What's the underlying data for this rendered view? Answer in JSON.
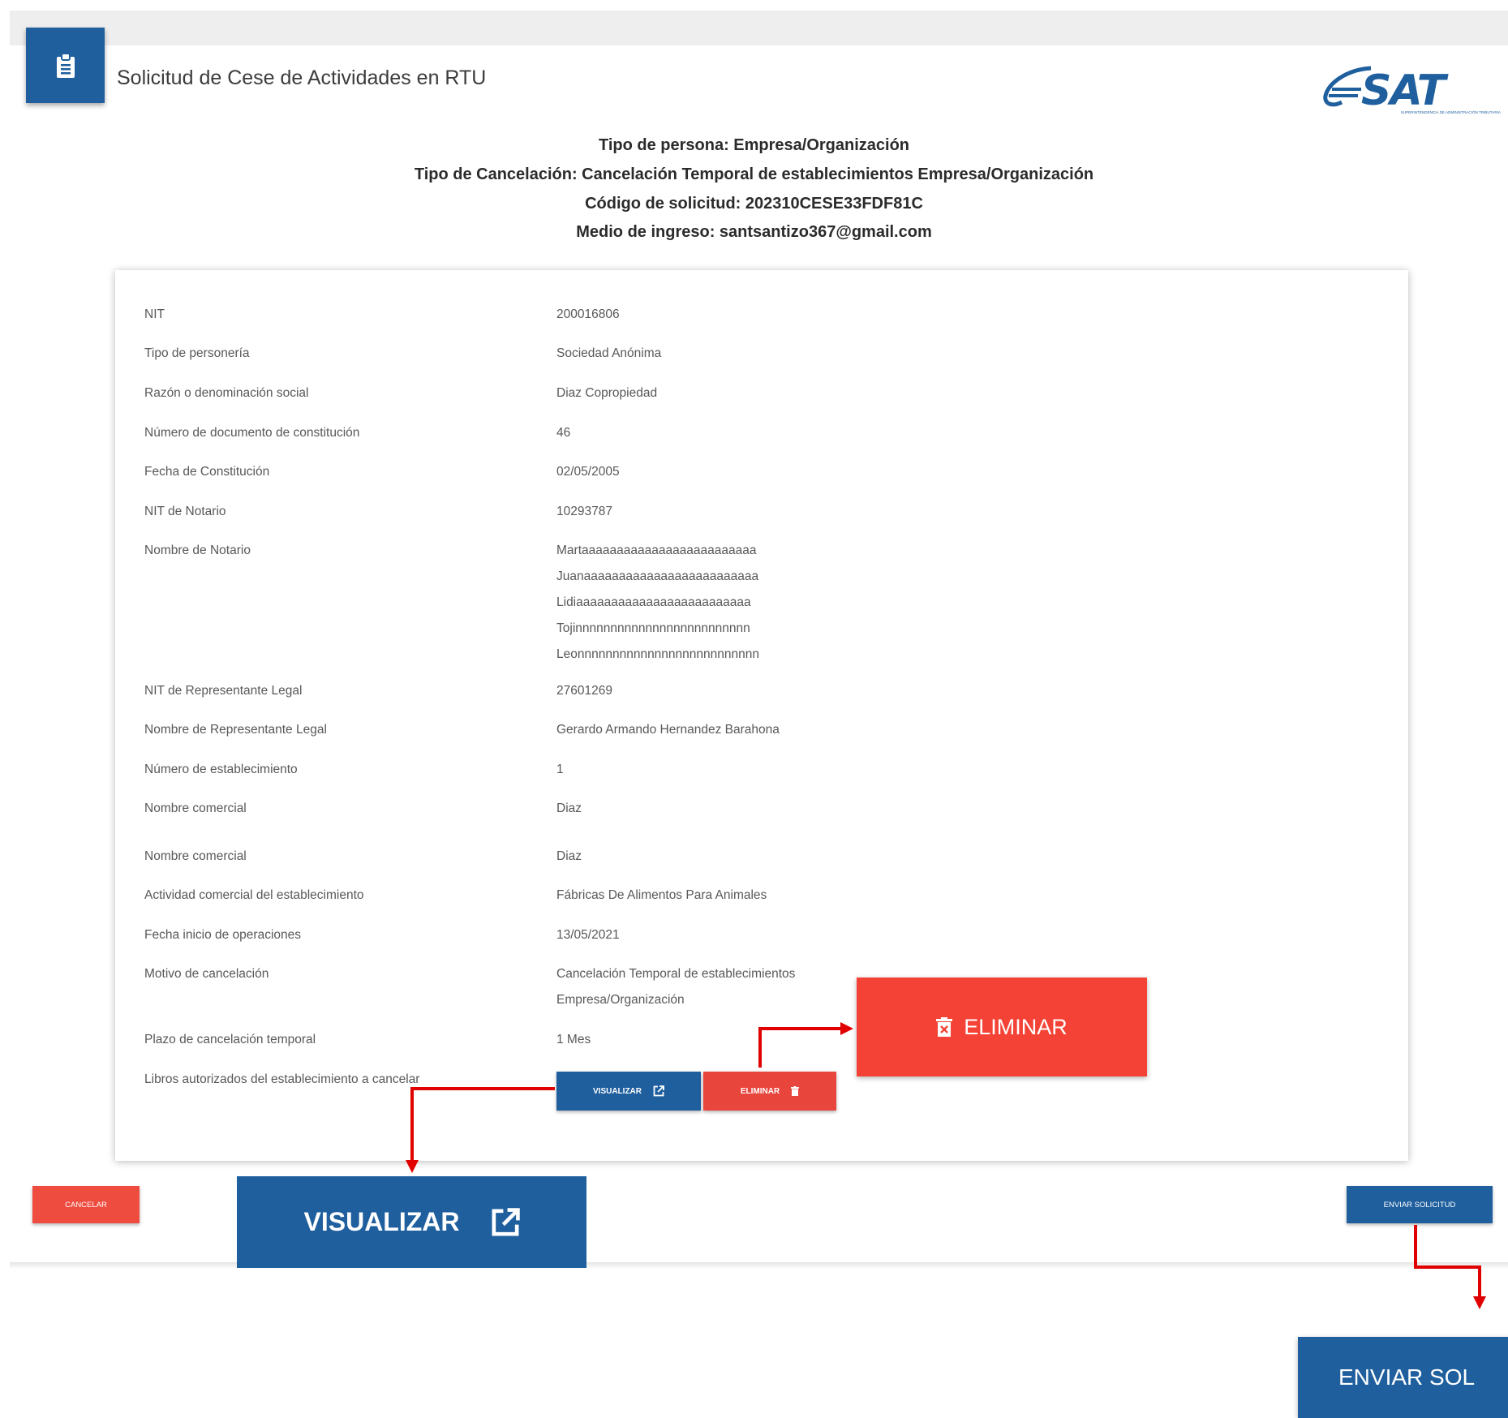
{
  "header": {
    "title": "Solicitud de Cese de Actividades en RTU",
    "icon": "clipboard-icon"
  },
  "logo": {
    "text": "SAT",
    "subtext": "SUPERINTENDENCIA DE ADMINISTRACIÓN TRIBUTARIA"
  },
  "summary": {
    "tipo_persona": "Tipo de persona: Empresa/Organización",
    "tipo_cancelacion": "Tipo de Cancelación: Cancelación Temporal de establecimientos Empresa/Organización",
    "codigo": "Código de solicitud: 202310CESE33FDF81C",
    "medio": "Medio de ingreso: santsantizo367@gmail.com"
  },
  "details": {
    "nit": {
      "label": "NIT",
      "value": "200016806"
    },
    "tipo_personeria": {
      "label": "Tipo de personería",
      "value": "Sociedad Anónima"
    },
    "razon": {
      "label": "Razón o denominación social",
      "value": "Diaz Copropiedad"
    },
    "num_documento": {
      "label": "Número de documento de constitución",
      "value": "46"
    },
    "fecha_constitucion": {
      "label": "Fecha de Constitución",
      "value": "02/05/2005"
    },
    "nit_notario": {
      "label": "NIT de Notario",
      "value": "10293787"
    },
    "nombre_notario": {
      "label": "Nombre de Notario",
      "lines": [
        "Martaaaaaaaaaaaaaaaaaaaaaaaaa",
        "Juanaaaaaaaaaaaaaaaaaaaaaaaaa",
        "Lidiaaaaaaaaaaaaaaaaaaaaaaaaa",
        "Tojinnnnnnnnnnnnnnnnnnnnnnnnn",
        "Leonnnnnnnnnnnnnnnnnnnnnnnnnn"
      ]
    },
    "nit_representante": {
      "label": "NIT de Representante Legal",
      "value": "27601269"
    },
    "nombre_representante": {
      "label": "Nombre de Representante Legal",
      "value": "Gerardo Armando Hernandez Barahona"
    },
    "num_establecimiento": {
      "label": "Número de establecimiento",
      "value": "1"
    },
    "nombre_comercial_1": {
      "label": "Nombre comercial",
      "value": "Diaz"
    },
    "nombre_comercial_2": {
      "label": "Nombre comercial",
      "value": "Diaz"
    },
    "actividad": {
      "label": "Actividad comercial del establecimiento",
      "value": "Fábricas De Alimentos Para Animales"
    },
    "fecha_inicio": {
      "label": "Fecha inicio de operaciones",
      "value": "13/05/2021"
    },
    "motivo": {
      "label": "Motivo de cancelación",
      "lines": [
        "Cancelación Temporal de establecimientos",
        "Empresa/Organización"
      ]
    },
    "plazo": {
      "label": "Plazo de cancelación temporal",
      "value": "1 Mes"
    },
    "libros": {
      "label": "Libros autorizados del establecimiento a cancelar"
    }
  },
  "buttons": {
    "visualizar": "VISUALIZAR",
    "eliminar": "ELIMINAR",
    "cancelar": "CANCELAR",
    "enviar": "ENVIAR SOLICITUD"
  },
  "callouts": {
    "eliminar": "ELIMINAR",
    "visualizar": "VISUALIZAR",
    "enviar": "ENVIAR SOL"
  },
  "colors": {
    "primary": "#1f5f9e",
    "danger": "#f44336",
    "arrow": "#e00000"
  }
}
